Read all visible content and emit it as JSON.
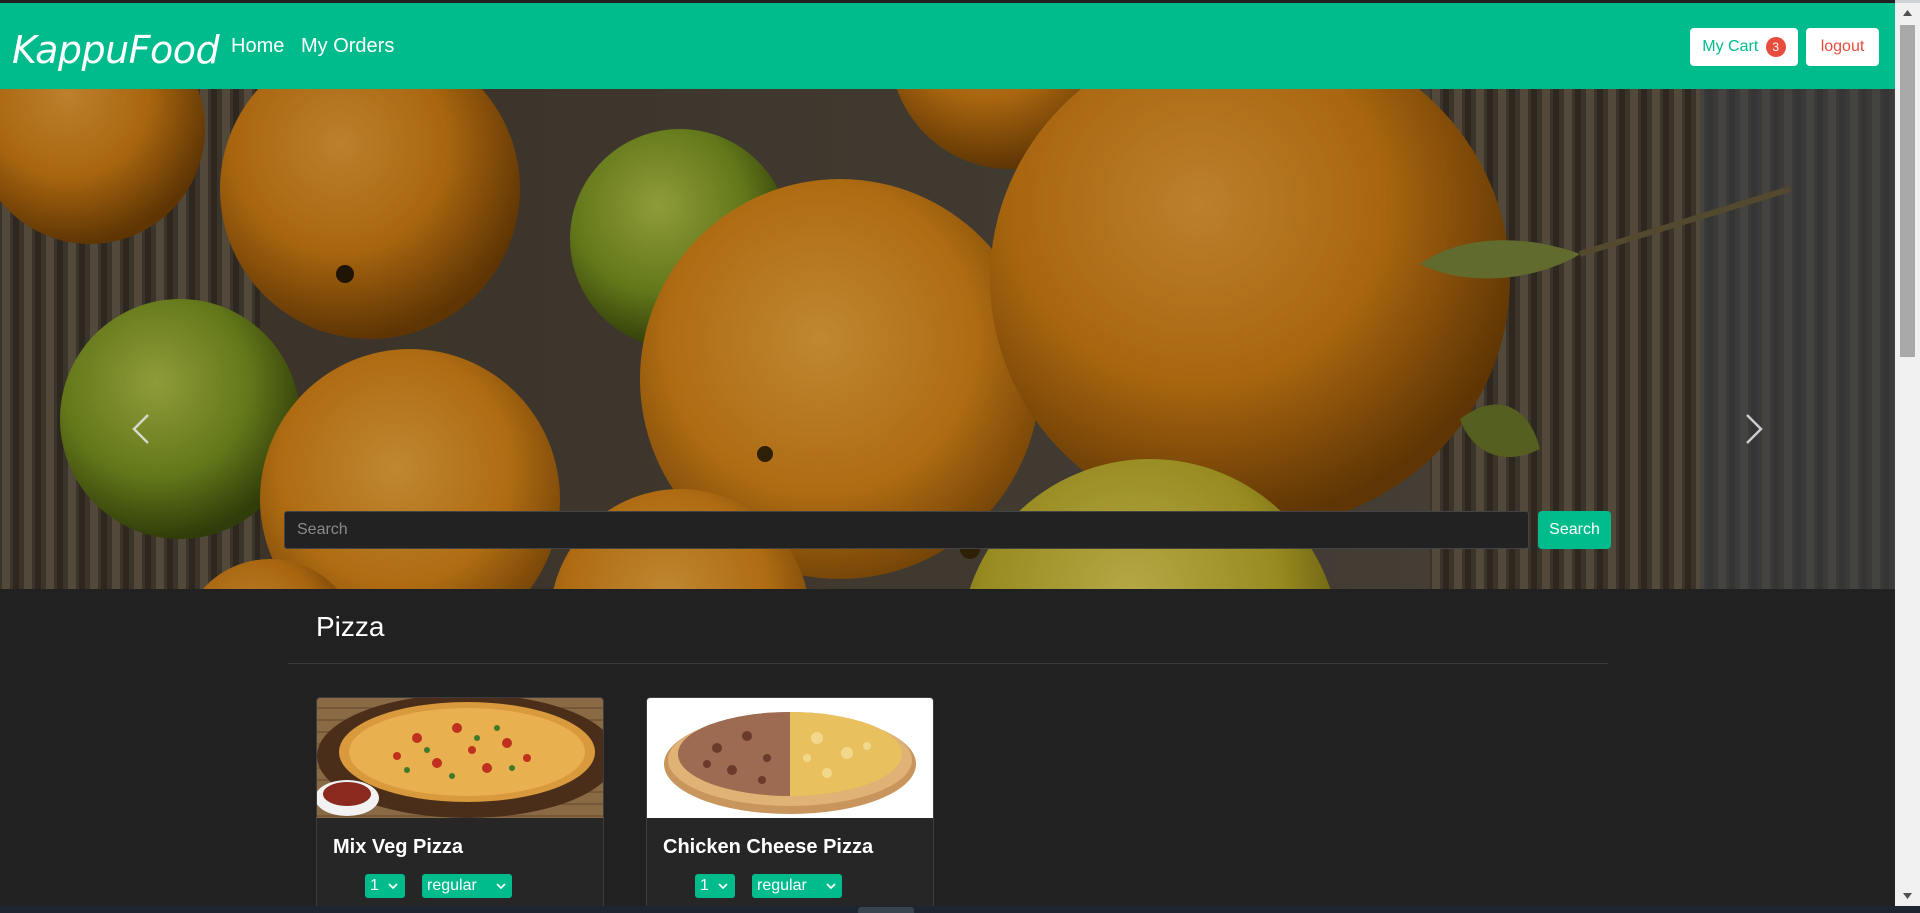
{
  "navbar": {
    "brand": "KappuFood",
    "links": [
      {
        "label": "Home"
      },
      {
        "label": "My Orders"
      }
    ],
    "cart": {
      "label": "My Cart",
      "count": "3"
    },
    "logout_label": "logout"
  },
  "hero": {
    "search": {
      "placeholder": "Search",
      "value": ""
    },
    "search_button": "Search"
  },
  "category": {
    "title": "Pizza",
    "items": [
      {
        "name": "Mix Veg Pizza",
        "quantity": "1",
        "size": "regular"
      },
      {
        "name": "Chicken Cheese Pizza",
        "quantity": "1",
        "size": "regular"
      }
    ]
  },
  "colors": {
    "accent": "#00bb8c",
    "background": "#212121",
    "danger": "#e74c3c"
  },
  "icons": {
    "carousel_prev": "chevron-left-icon",
    "carousel_next": "chevron-right-icon",
    "select_caret": "chevron-down-icon"
  }
}
